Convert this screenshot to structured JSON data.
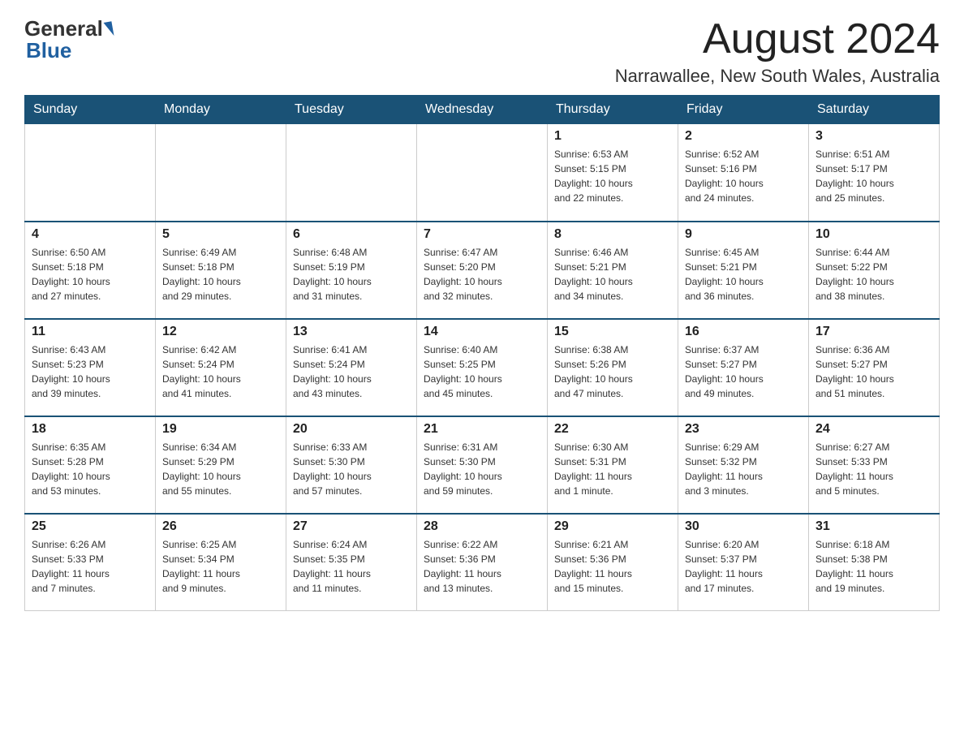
{
  "header": {
    "logo_general": "General",
    "logo_blue": "Blue",
    "month_title": "August 2024",
    "location": "Narrawallee, New South Wales, Australia"
  },
  "days_of_week": [
    "Sunday",
    "Monday",
    "Tuesday",
    "Wednesday",
    "Thursday",
    "Friday",
    "Saturday"
  ],
  "weeks": [
    [
      {
        "day": "",
        "info": ""
      },
      {
        "day": "",
        "info": ""
      },
      {
        "day": "",
        "info": ""
      },
      {
        "day": "",
        "info": ""
      },
      {
        "day": "1",
        "info": "Sunrise: 6:53 AM\nSunset: 5:15 PM\nDaylight: 10 hours\nand 22 minutes."
      },
      {
        "day": "2",
        "info": "Sunrise: 6:52 AM\nSunset: 5:16 PM\nDaylight: 10 hours\nand 24 minutes."
      },
      {
        "day": "3",
        "info": "Sunrise: 6:51 AM\nSunset: 5:17 PM\nDaylight: 10 hours\nand 25 minutes."
      }
    ],
    [
      {
        "day": "4",
        "info": "Sunrise: 6:50 AM\nSunset: 5:18 PM\nDaylight: 10 hours\nand 27 minutes."
      },
      {
        "day": "5",
        "info": "Sunrise: 6:49 AM\nSunset: 5:18 PM\nDaylight: 10 hours\nand 29 minutes."
      },
      {
        "day": "6",
        "info": "Sunrise: 6:48 AM\nSunset: 5:19 PM\nDaylight: 10 hours\nand 31 minutes."
      },
      {
        "day": "7",
        "info": "Sunrise: 6:47 AM\nSunset: 5:20 PM\nDaylight: 10 hours\nand 32 minutes."
      },
      {
        "day": "8",
        "info": "Sunrise: 6:46 AM\nSunset: 5:21 PM\nDaylight: 10 hours\nand 34 minutes."
      },
      {
        "day": "9",
        "info": "Sunrise: 6:45 AM\nSunset: 5:21 PM\nDaylight: 10 hours\nand 36 minutes."
      },
      {
        "day": "10",
        "info": "Sunrise: 6:44 AM\nSunset: 5:22 PM\nDaylight: 10 hours\nand 38 minutes."
      }
    ],
    [
      {
        "day": "11",
        "info": "Sunrise: 6:43 AM\nSunset: 5:23 PM\nDaylight: 10 hours\nand 39 minutes."
      },
      {
        "day": "12",
        "info": "Sunrise: 6:42 AM\nSunset: 5:24 PM\nDaylight: 10 hours\nand 41 minutes."
      },
      {
        "day": "13",
        "info": "Sunrise: 6:41 AM\nSunset: 5:24 PM\nDaylight: 10 hours\nand 43 minutes."
      },
      {
        "day": "14",
        "info": "Sunrise: 6:40 AM\nSunset: 5:25 PM\nDaylight: 10 hours\nand 45 minutes."
      },
      {
        "day": "15",
        "info": "Sunrise: 6:38 AM\nSunset: 5:26 PM\nDaylight: 10 hours\nand 47 minutes."
      },
      {
        "day": "16",
        "info": "Sunrise: 6:37 AM\nSunset: 5:27 PM\nDaylight: 10 hours\nand 49 minutes."
      },
      {
        "day": "17",
        "info": "Sunrise: 6:36 AM\nSunset: 5:27 PM\nDaylight: 10 hours\nand 51 minutes."
      }
    ],
    [
      {
        "day": "18",
        "info": "Sunrise: 6:35 AM\nSunset: 5:28 PM\nDaylight: 10 hours\nand 53 minutes."
      },
      {
        "day": "19",
        "info": "Sunrise: 6:34 AM\nSunset: 5:29 PM\nDaylight: 10 hours\nand 55 minutes."
      },
      {
        "day": "20",
        "info": "Sunrise: 6:33 AM\nSunset: 5:30 PM\nDaylight: 10 hours\nand 57 minutes."
      },
      {
        "day": "21",
        "info": "Sunrise: 6:31 AM\nSunset: 5:30 PM\nDaylight: 10 hours\nand 59 minutes."
      },
      {
        "day": "22",
        "info": "Sunrise: 6:30 AM\nSunset: 5:31 PM\nDaylight: 11 hours\nand 1 minute."
      },
      {
        "day": "23",
        "info": "Sunrise: 6:29 AM\nSunset: 5:32 PM\nDaylight: 11 hours\nand 3 minutes."
      },
      {
        "day": "24",
        "info": "Sunrise: 6:27 AM\nSunset: 5:33 PM\nDaylight: 11 hours\nand 5 minutes."
      }
    ],
    [
      {
        "day": "25",
        "info": "Sunrise: 6:26 AM\nSunset: 5:33 PM\nDaylight: 11 hours\nand 7 minutes."
      },
      {
        "day": "26",
        "info": "Sunrise: 6:25 AM\nSunset: 5:34 PM\nDaylight: 11 hours\nand 9 minutes."
      },
      {
        "day": "27",
        "info": "Sunrise: 6:24 AM\nSunset: 5:35 PM\nDaylight: 11 hours\nand 11 minutes."
      },
      {
        "day": "28",
        "info": "Sunrise: 6:22 AM\nSunset: 5:36 PM\nDaylight: 11 hours\nand 13 minutes."
      },
      {
        "day": "29",
        "info": "Sunrise: 6:21 AM\nSunset: 5:36 PM\nDaylight: 11 hours\nand 15 minutes."
      },
      {
        "day": "30",
        "info": "Sunrise: 6:20 AM\nSunset: 5:37 PM\nDaylight: 11 hours\nand 17 minutes."
      },
      {
        "day": "31",
        "info": "Sunrise: 6:18 AM\nSunset: 5:38 PM\nDaylight: 11 hours\nand 19 minutes."
      }
    ]
  ]
}
